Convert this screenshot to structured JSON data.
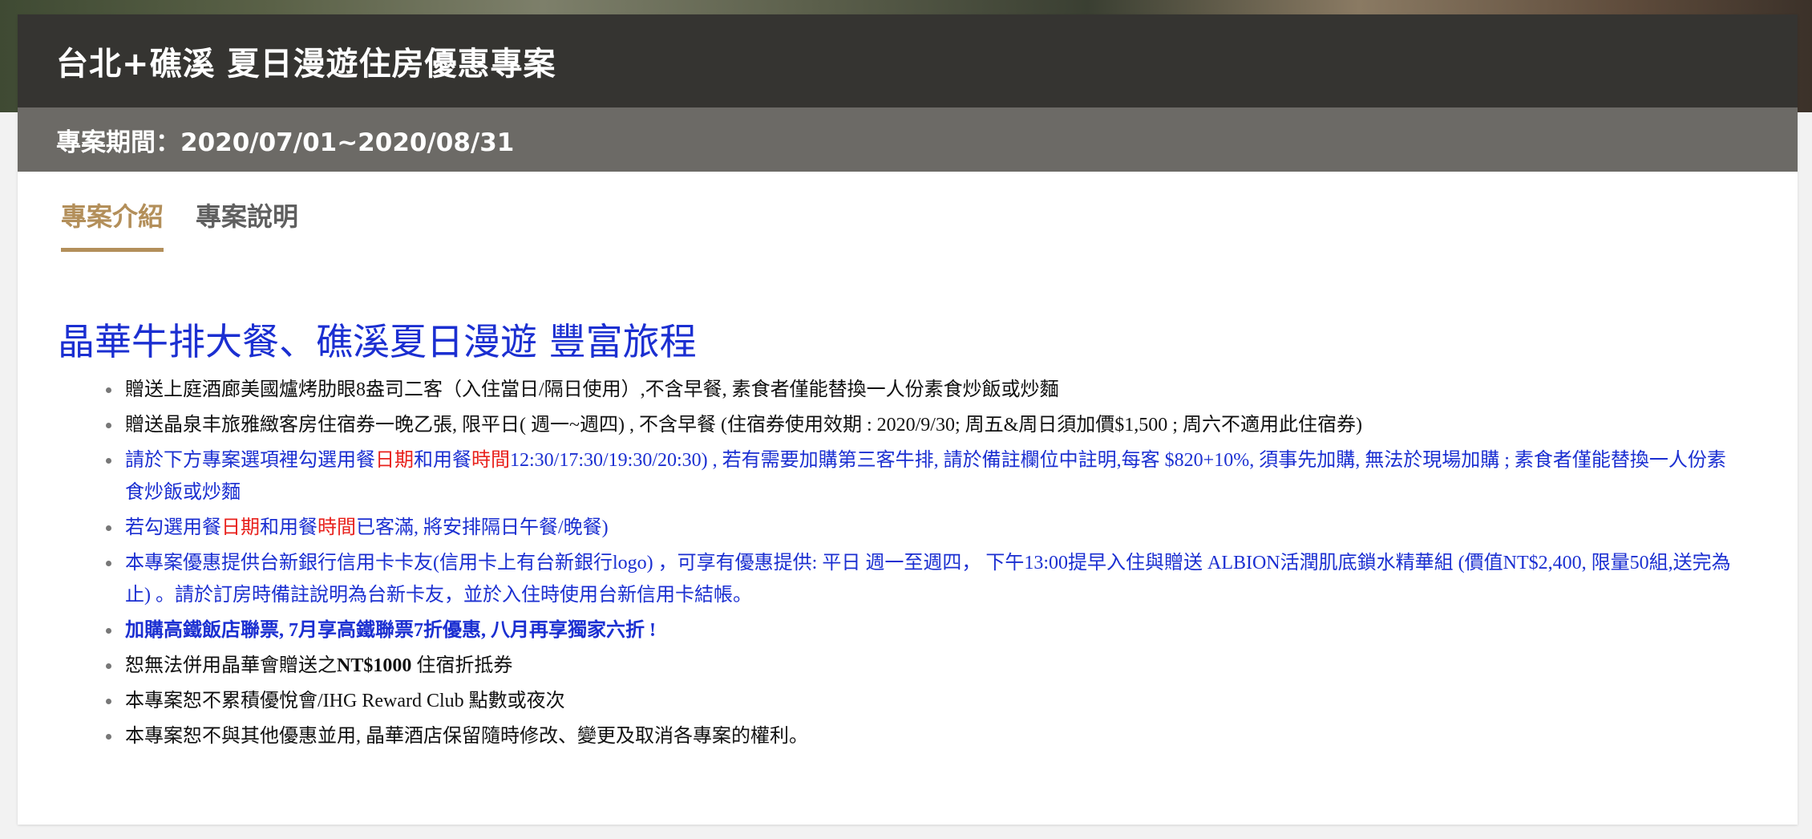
{
  "header": {
    "title": "台北+礁溪 夏日漫遊住房優惠專案",
    "period": "專案期間：2020/07/01~2020/08/31"
  },
  "tabs": [
    {
      "label": "專案介紹",
      "active": true
    },
    {
      "label": "專案說明",
      "active": false
    }
  ],
  "content": {
    "headline": "晶華牛排大餐、礁溪夏日漫遊 豐富旅程",
    "items": [
      {
        "text": "贈送上庭酒廊美國爐烤肋眼8盎司二客（入住當日/隔日使用）,不含早餐, 素食者僅能替換一人份素食炒飯或炒麵"
      },
      {
        "text": "贈送晶泉丰旅雅緻客房住宿券一晚乙張, 限平日( 週一~週四) , 不含早餐 (住宿券使用效期 : 2020/9/30; 周五&周日須加價$1,500 ; 周六不適用此住宿券)"
      },
      {
        "p1": "請於下方專案選項裡勾選用餐",
        "red1": "日期",
        "p2": "和用餐",
        "red2": "時間",
        "p3": "12:30/17:30/19:30/20:30) , 若有需要加購第三客牛排, 請於備註欄位中註明,每客 $820+10%, 須事先加購, 無法於現場加購 ; 素食者僅能替換一人份素食炒飯或炒麵"
      },
      {
        "p1": "若勾選用餐",
        "red1": "日期",
        "p2": "和用餐",
        "red2": "時間",
        "p3": "已客滿, 將安排隔日午餐/晚餐)"
      },
      {
        "text": "本專案優惠提供台新銀行信用卡卡友(信用卡上有台新銀行logo) ，可享有優惠提供: 平日 週一至週四， 下午13:00提早入住與贈送 ALBION活潤肌底鎖水精華組 (價值NT$2,400, 限量50組,送完為止) 。請於訂房時備註說明為台新卡友，並於入住時使用台新信用卡結帳。"
      },
      {
        "text": "加購高鐵飯店聯票, 7月享高鐵聯票7折優惠, 八月再享獨家六折 !"
      },
      {
        "p1": "恕無法併用晶華會贈送之",
        "bold": "NT$1000",
        "p2": " 住宿折抵券"
      },
      {
        "text": "本專案恕不累積優悅會/IHG Reward Club 點數或夜次"
      },
      {
        "text": "本專案恕不與其他優惠並用, 晶華酒店保留隨時修改、變更及取消各專案的權利。"
      }
    ]
  },
  "colors": {
    "title_bar": "#353431",
    "period_bar": "#6c6a66",
    "tab_active": "#b38f5a",
    "headline_blue": "#1b2fd1",
    "highlight_red": "#e8211c"
  }
}
